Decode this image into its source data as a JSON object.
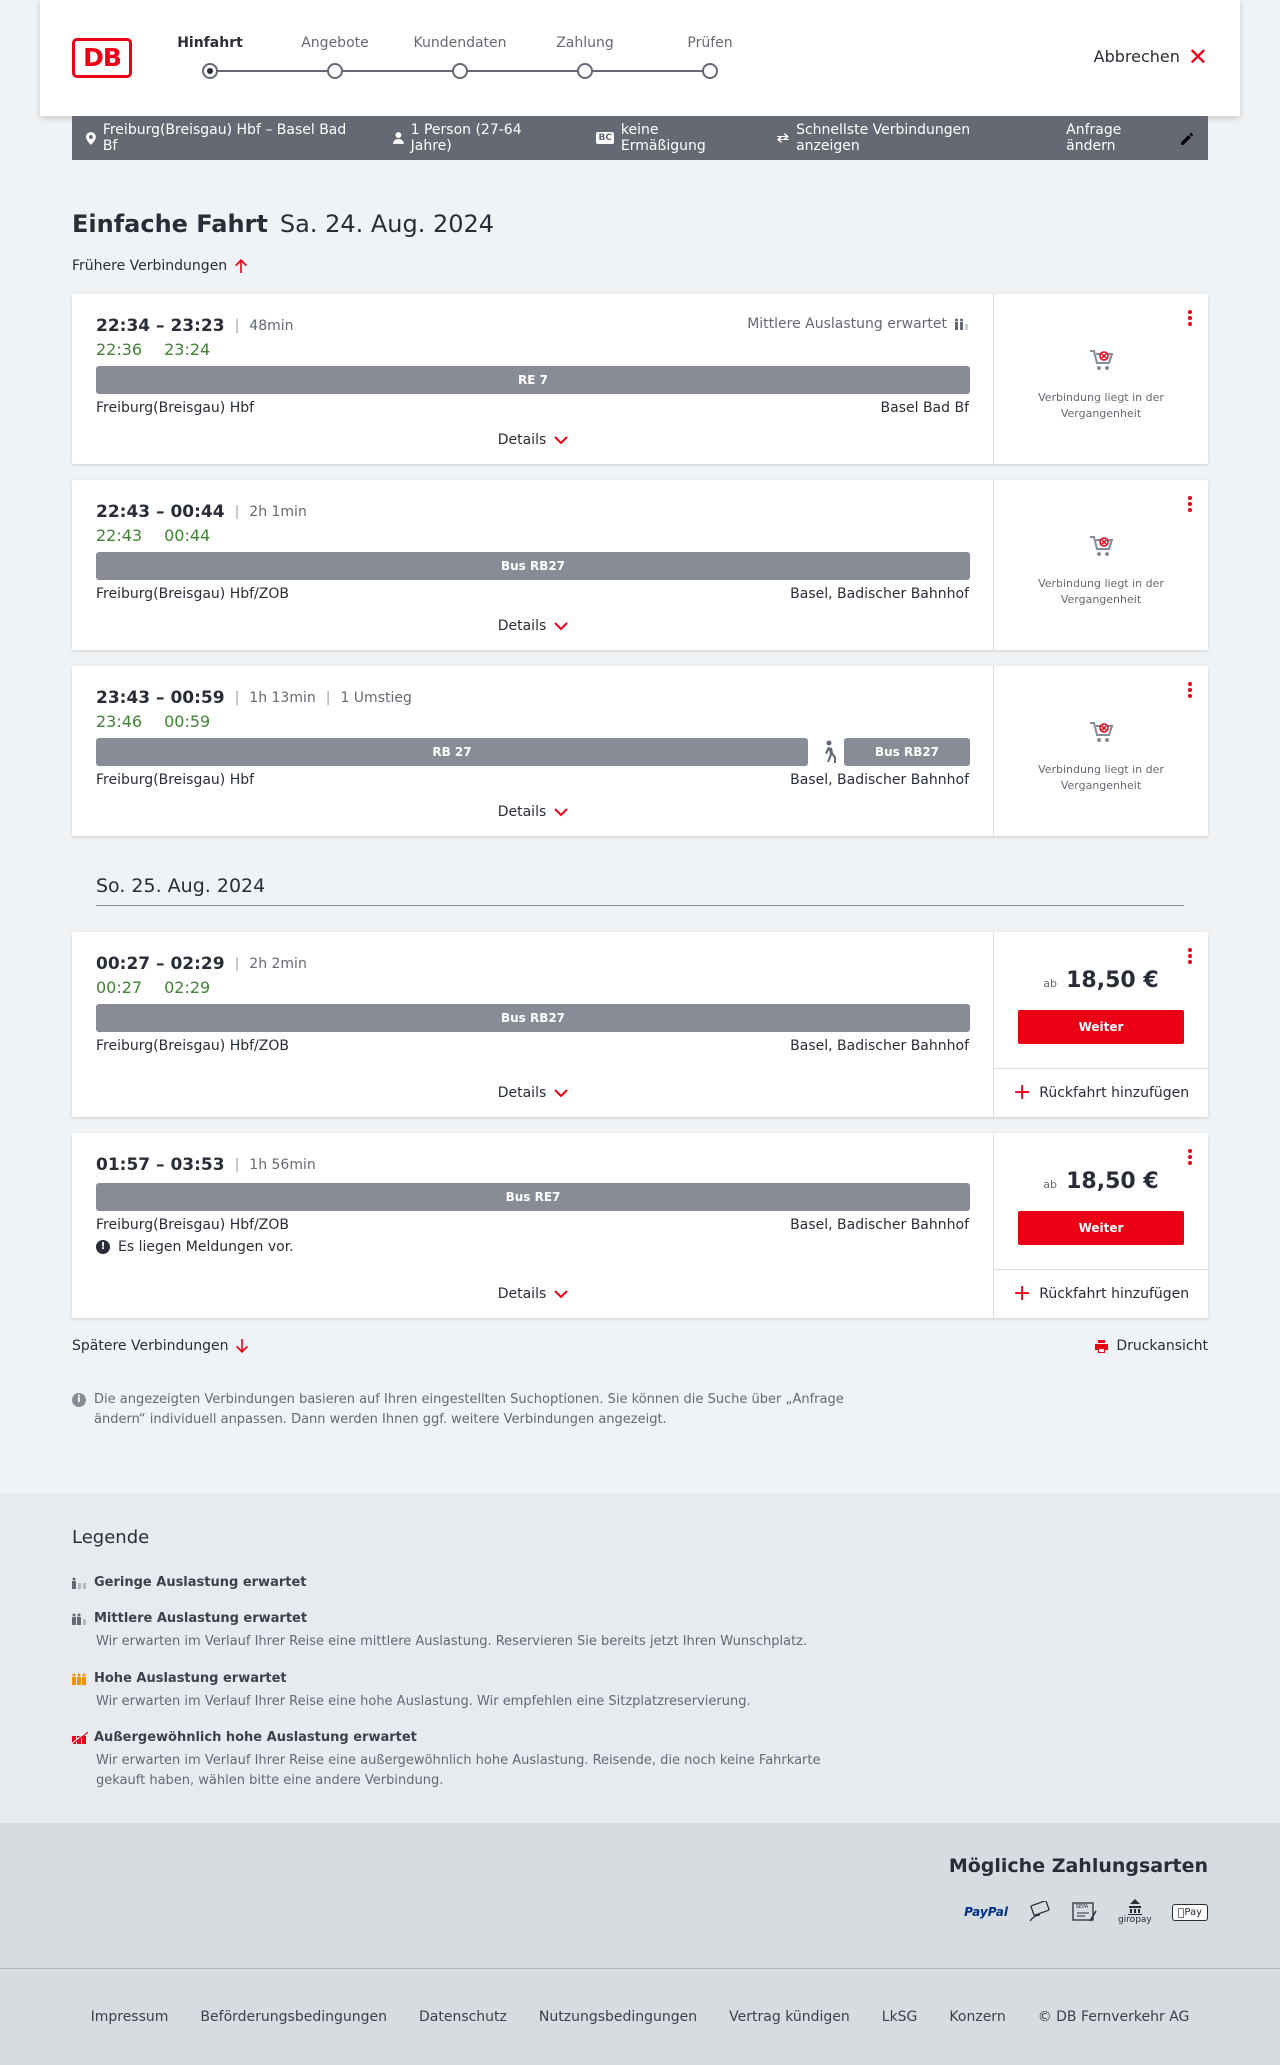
{
  "header": {
    "logo_text": "DB",
    "steps": [
      "Hinfahrt",
      "Angebote",
      "Kundendaten",
      "Zahlung",
      "Prüfen"
    ],
    "cancel_label": "Abbrechen"
  },
  "searchbar": {
    "route": "Freiburg(Breisgau) Hbf – Basel Bad Bf",
    "persons": "1 Person (27-64 Jahre)",
    "bc_badge": "BC",
    "discount": "keine Ermäßigung",
    "fastest": "Schnellste Verbindungen anzeigen",
    "edit": "Anfrage ändern"
  },
  "page": {
    "title": "Einfache Fahrt",
    "date": "Sa. 24. Aug. 2024",
    "earlier": "Frühere Verbindungen",
    "later": "Spätere Verbindungen",
    "print": "Druckansicht",
    "day2": "So. 25. Aug. 2024",
    "details_label": "Details",
    "past_label": "Verbindung liegt in der Vergangenheit",
    "price_prefix": "ab",
    "weiter_label": "Weiter",
    "return_label": "Rückfahrt hinzufügen",
    "info": "Die angezeigten Verbindungen basieren auf Ihren eingestellten Suchoptionen. Sie können die Suche über „Anfrage ändern“ individuell anpassen. Dann werden Ihnen ggf. weitere Verbindungen angezeigt."
  },
  "connections": [
    {
      "times": "22:34 – 23:23",
      "duration": "48min",
      "changes": "",
      "rt_dep": "22:36",
      "rt_arr": "23:24",
      "occupancy": "Mittlere Auslastung erwartet",
      "segments": [
        "RE 7"
      ],
      "from": "Freiburg(Breisgau) Hbf",
      "to": "Basel Bad Bf",
      "notice": ""
    },
    {
      "times": "22:43 – 00:44",
      "duration": "2h 1min",
      "changes": "",
      "rt_dep": "22:43",
      "rt_arr": "00:44",
      "occupancy": "",
      "segments": [
        "Bus RB27"
      ],
      "from": "Freiburg(Breisgau) Hbf/ZOB",
      "to": "Basel, Badischer Bahnhof",
      "notice": ""
    },
    {
      "times": "23:43 – 00:59",
      "duration": "1h 13min",
      "changes": "1 Umstieg",
      "rt_dep": "23:46",
      "rt_arr": "00:59",
      "occupancy": "",
      "segments": [
        "RB 27",
        "Bus RB27"
      ],
      "from": "Freiburg(Breisgau) Hbf",
      "to": "Basel, Badischer Bahnhof",
      "notice": ""
    },
    {
      "times": "00:27 – 02:29",
      "duration": "2h 2min",
      "changes": "",
      "rt_dep": "00:27",
      "rt_arr": "02:29",
      "occupancy": "",
      "segments": [
        "Bus RB27"
      ],
      "from": "Freiburg(Breisgau) Hbf/ZOB",
      "to": "Basel, Badischer Bahnhof",
      "notice": "",
      "price": "18,50 €"
    },
    {
      "times": "01:57 – 03:53",
      "duration": "1h 56min",
      "changes": "",
      "rt_dep": "",
      "rt_arr": "",
      "occupancy": "",
      "segments": [
        "Bus RE7"
      ],
      "from": "Freiburg(Breisgau) Hbf/ZOB",
      "to": "Basel, Badischer Bahnhof",
      "notice": "Es liegen Meldungen vor.",
      "price": "18,50 €"
    }
  ],
  "legend": {
    "title": "Legende",
    "items": [
      {
        "title": "Geringe Auslastung erwartet",
        "desc": ""
      },
      {
        "title": "Mittlere Auslastung erwartet",
        "desc": "Wir erwarten im Verlauf Ihrer Reise eine mittlere Auslastung. Reservieren Sie bereits jetzt Ihren Wunschplatz."
      },
      {
        "title": "Hohe Auslastung erwartet",
        "desc": "Wir erwarten im Verlauf Ihrer Reise eine hohe Auslastung. Wir empfehlen eine Sitzplatzreservierung."
      },
      {
        "title": "Außergewöhnlich hohe Auslastung erwartet",
        "desc": "Wir erwarten im Verlauf Ihrer Reise eine außergewöhnlich hohe Auslastung. Reisende, die noch keine Fahrkarte gekauft haben, wählen bitte eine andere Verbindung."
      }
    ],
    "colors": {
      "low": "#646973",
      "mid": "#646973",
      "high": "#f39200",
      "very_high": "#ec0016"
    }
  },
  "payments": {
    "title": "Mögliche Zahlungsarten",
    "paypal": "PayPal",
    "sepa": "SEPA",
    "giropay": "giropay",
    "applepay": "Pay"
  },
  "footer": [
    "Impressum",
    "Beförderungsbedingungen",
    "Datenschutz",
    "Nutzungsbedingungen",
    "Vertrag kündigen",
    "LkSG",
    "Konzern",
    "© DB Fernverkehr AG"
  ],
  "colors": {
    "brand_red": "#ec0016",
    "realtime_green": "#408335",
    "bar_gray": "#878c96"
  }
}
